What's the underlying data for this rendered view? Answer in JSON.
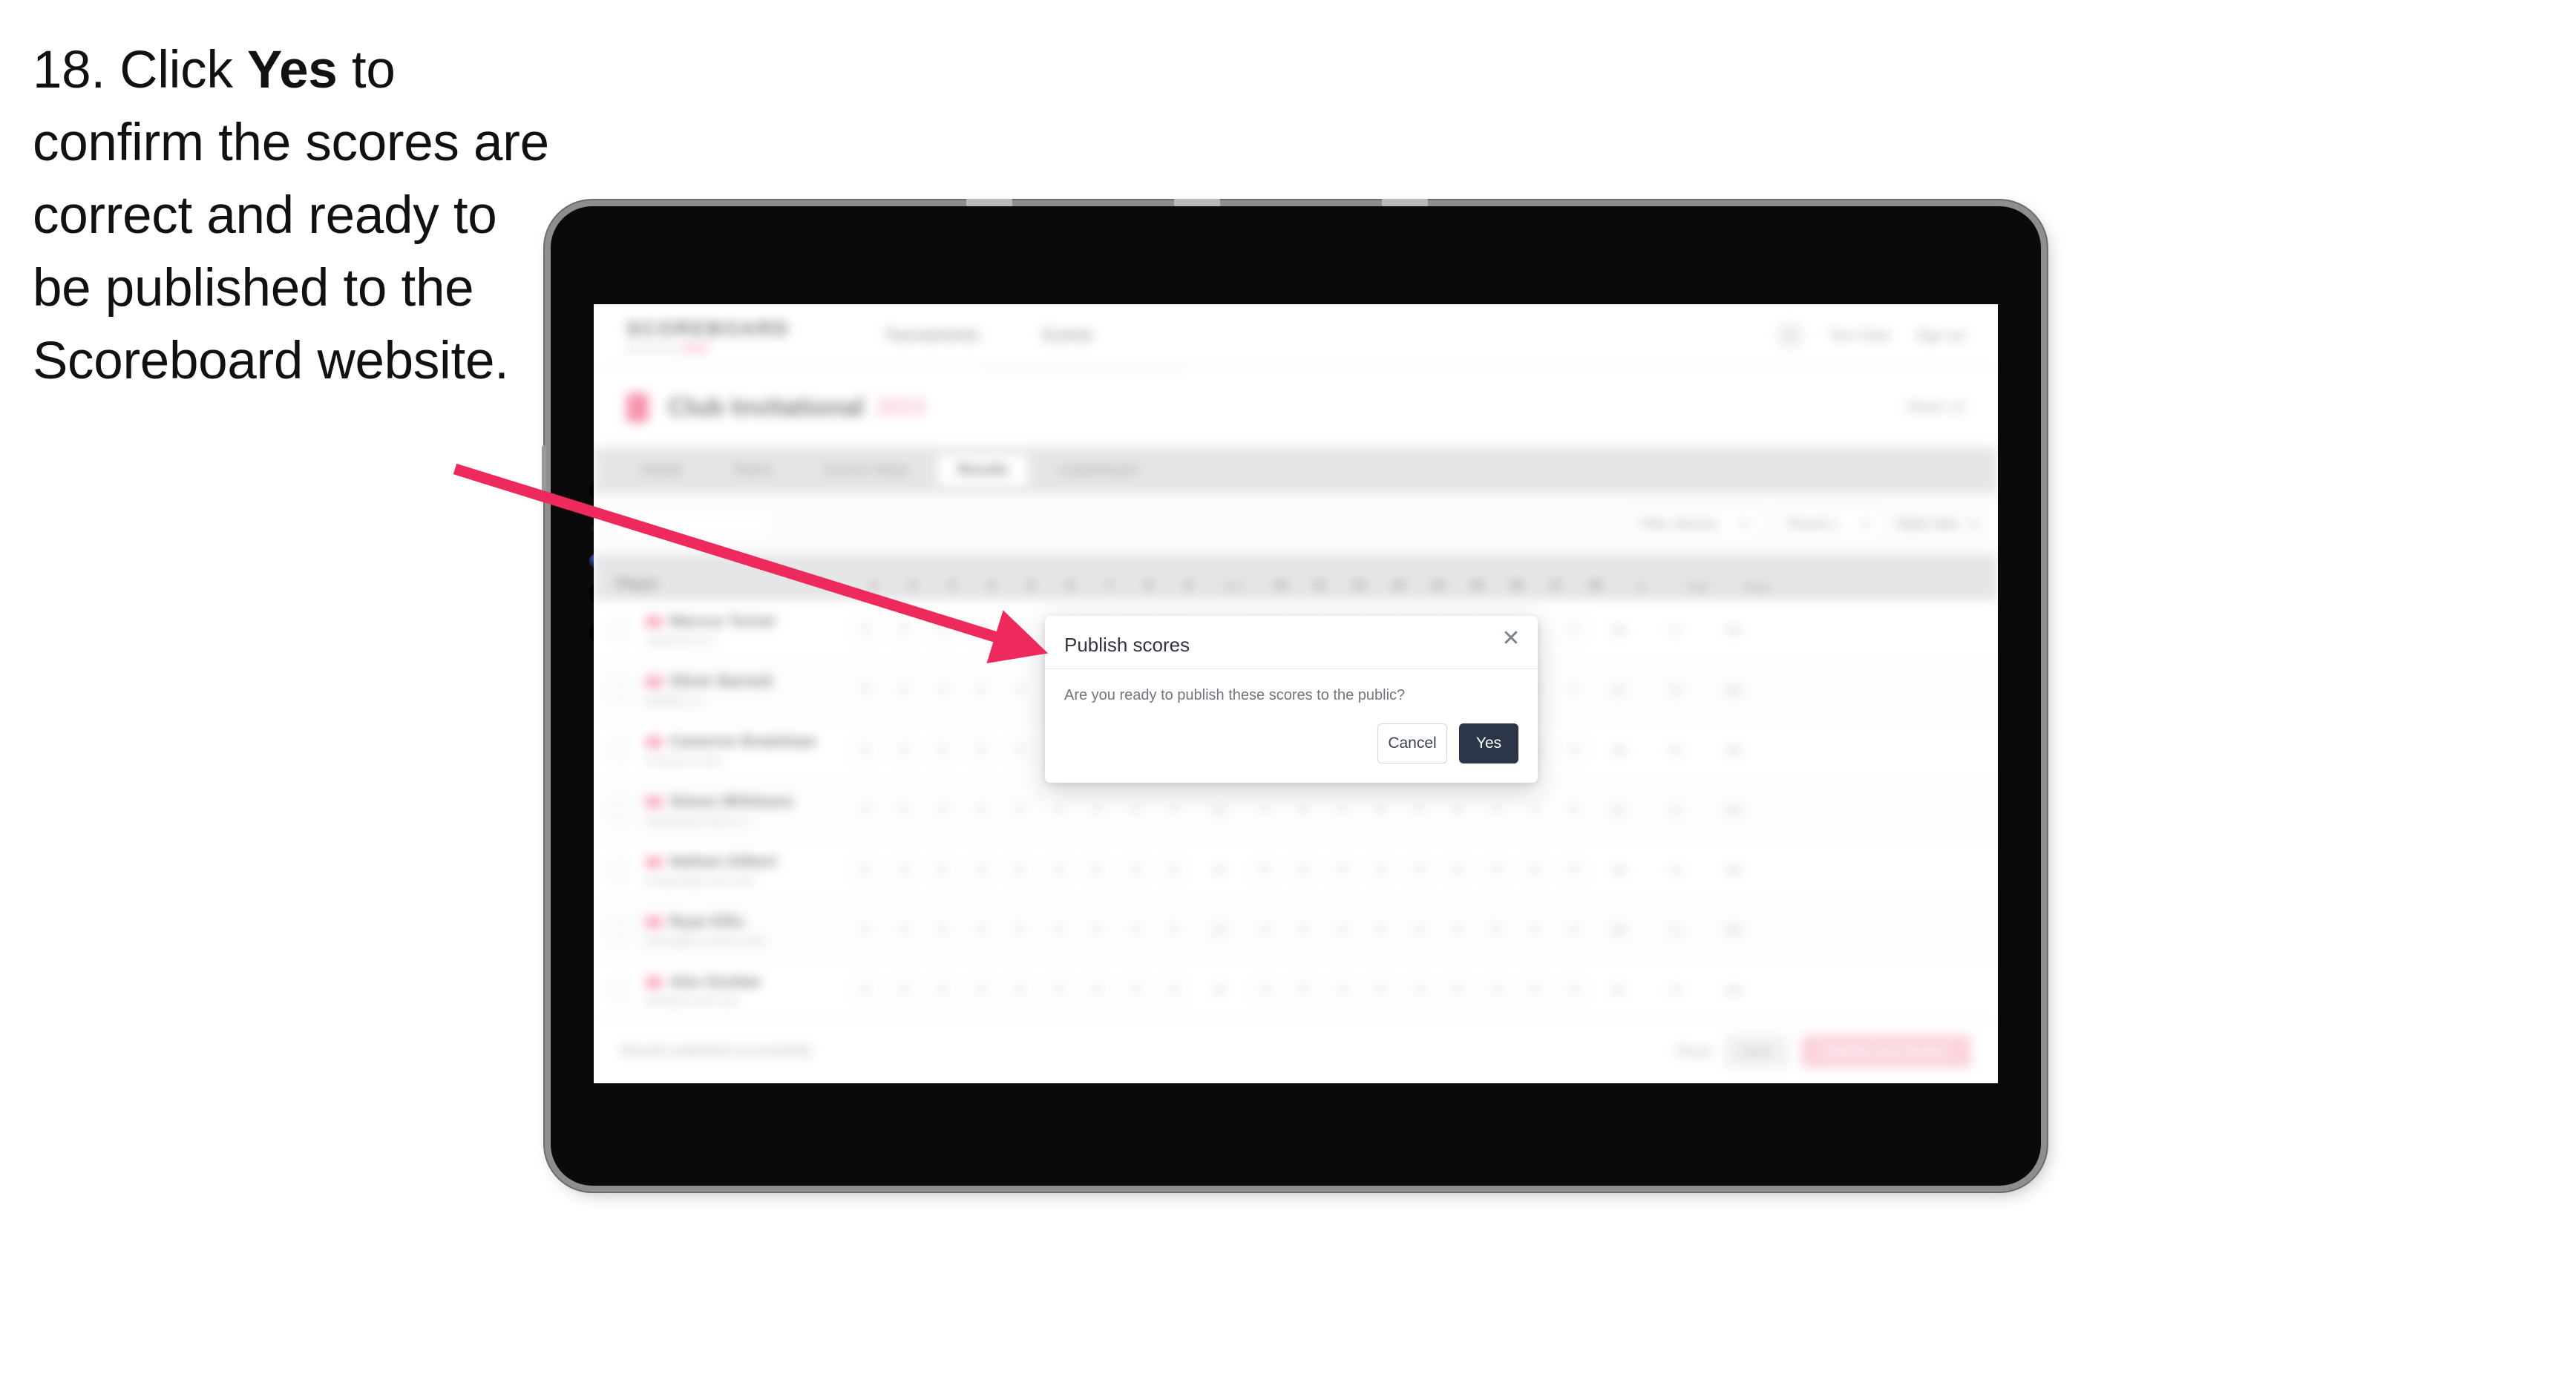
{
  "instruction": {
    "prefix": "18. Click ",
    "bold": "Yes",
    "suffix": " to confirm the scores are correct and ready to be published to the Scoreboard website."
  },
  "app": {
    "brand": {
      "title": "SCOREBOARD",
      "sub_prefix": "powered by ",
      "sub_accent": "GOLF"
    },
    "nav": [
      "Tournaments",
      "Events"
    ],
    "header_right": {
      "user": "Tom Clark",
      "signout": "Sign out"
    },
    "event": {
      "title": "Club Invitational",
      "status": "2023",
      "right_meta": "Week 12"
    },
    "tabs": [
      {
        "label": "Details",
        "active": false
      },
      {
        "label": "Teams",
        "active": false
      },
      {
        "label": "Course Setup",
        "active": false
      },
      {
        "label": "Results",
        "active": true
      },
      {
        "label": "Leaderboard",
        "active": false
      }
    ],
    "filters": {
      "search_placeholder": "Search",
      "division": "Filter division",
      "round": "Round 1",
      "view": "Table view"
    },
    "table": {
      "player_header": "Player",
      "holes": [
        "1",
        "2",
        "3",
        "4",
        "5",
        "6",
        "7",
        "8",
        "9",
        "10",
        "11",
        "12",
        "13",
        "14",
        "15",
        "16",
        "17",
        "18"
      ],
      "out_header": "OUT",
      "in_header": "IN",
      "r_header": "R",
      "total_header": "Total",
      "status_header": "Status",
      "rows": [
        {
          "name": "Marcus Turner",
          "club": "Oakwood G.C.",
          "scores": [
            "4",
            "5",
            "3",
            "4",
            "5",
            "4",
            "3",
            "4",
            "4",
            "4",
            "5",
            "3",
            "4",
            "4",
            "5",
            "4",
            "3",
            "4"
          ],
          "out": "36",
          "in": "36",
          "total": "+1",
          "status": "OK"
        },
        {
          "name": "Oliver Barnett",
          "club": "Redhill C.C.",
          "scores": [
            "5",
            "4",
            "4",
            "4",
            "4",
            "5",
            "3",
            "4",
            "4",
            "5",
            "4",
            "4",
            "3",
            "5",
            "4",
            "4",
            "4",
            "4"
          ],
          "out": "37",
          "in": "37",
          "total": "+3",
          "status": "OK"
        },
        {
          "name": "Cameron Bradshaw",
          "club": "Pinehurst Links",
          "scores": [
            "4",
            "4",
            "3",
            "5",
            "4",
            "4",
            "4",
            "3",
            "5",
            "4",
            "4",
            "3",
            "4",
            "4",
            "5",
            "5",
            "3",
            "4"
          ],
          "out": "36",
          "in": "36",
          "total": "+0",
          "status": "OK"
        },
        {
          "name": "Simon Whitmore",
          "club": "Hazelwood Park G.C.",
          "scores": [
            "4",
            "5",
            "4",
            "4",
            "5",
            "4",
            "3",
            "4",
            "4",
            "4",
            "4",
            "4",
            "4",
            "5",
            "4",
            "3",
            "4",
            "5"
          ],
          "out": "37",
          "in": "37",
          "total": "+2",
          "status": "OK"
        },
        {
          "name": "Nathan Gilbert",
          "club": "Kingsbridge Golf Club",
          "scores": [
            "5",
            "4",
            "4",
            "4",
            "4",
            "4",
            "4",
            "4",
            "4",
            "5",
            "5",
            "4",
            "3",
            "4",
            "4",
            "4",
            "4",
            "4"
          ],
          "out": "37",
          "in": "38",
          "total": "+4",
          "status": "OK"
        },
        {
          "name": "Ryan Ellis",
          "club": "Stonegate Country Club",
          "scores": [
            "4",
            "4",
            "3",
            "4",
            "5",
            "4",
            "4",
            "4",
            "5",
            "4",
            "4",
            "4",
            "4",
            "4",
            "4",
            "5",
            "3",
            "4"
          ],
          "out": "37",
          "in": "36",
          "total": "+1",
          "status": "OK"
        },
        {
          "name": "Alex Dunbar",
          "club": "Whitfield Golf Club",
          "scores": [
            "4",
            "5",
            "4",
            "5",
            "4",
            "4",
            "3",
            "4",
            "4",
            "4",
            "5",
            "4",
            "4",
            "4",
            "4",
            "4",
            "4",
            "4"
          ],
          "out": "37",
          "in": "37",
          "total": "+3",
          "status": "OK"
        }
      ]
    },
    "footer": {
      "status": "Results published successfully",
      "link": "Reset",
      "secondary": "Save",
      "primary": "Publish and finalise"
    }
  },
  "modal": {
    "title": "Publish scores",
    "close_icon": "close-icon",
    "message": "Are you ready to publish these scores to the public?",
    "cancel_label": "Cancel",
    "confirm_label": "Yes"
  },
  "colors": {
    "accent_pink": "#ee2a5d",
    "confirm_navy": "#2b3648",
    "device_bezel": "#0a0a0a"
  }
}
